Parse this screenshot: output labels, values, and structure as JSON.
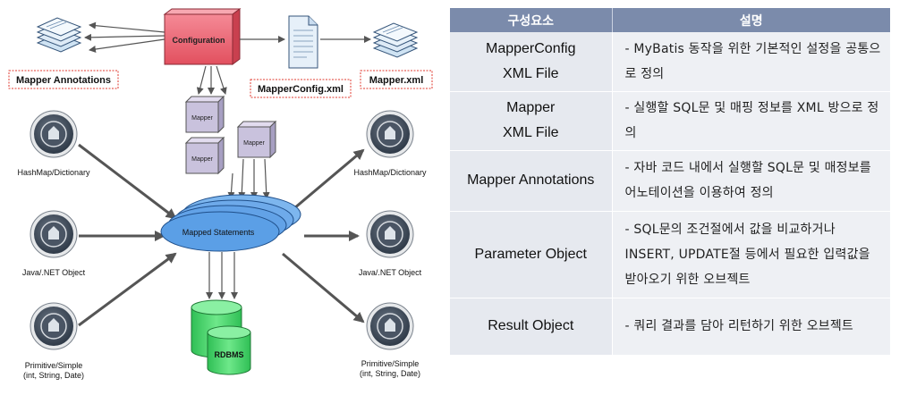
{
  "diagram": {
    "configuration": "Configuration",
    "mapper_annotations": "Mapper Annotations",
    "mapper_config_xml": "MapperConfig.xml",
    "mapper_xml": "Mapper.xml",
    "mapper": "Mapper",
    "mapped_statements": "Mapped Statements",
    "rdbms": "RDBMS",
    "inputs": [
      {
        "label": "HashMap/Dictionary"
      },
      {
        "label": "Java/.NET Object"
      },
      {
        "label_lines": [
          "Primitive/Simple",
          "(int, String, Date)"
        ]
      }
    ],
    "outputs": [
      {
        "label": "HashMap/Dictionary"
      },
      {
        "label": "Java/.NET Object"
      },
      {
        "label_lines": [
          "Primitive/Simple",
          "(int, String, Date)"
        ]
      }
    ],
    "colors": {
      "configuration_fill": "#f06b7a",
      "mapper_fill": "#c9c2dd",
      "ellipse_fill": "#5b9fe6",
      "db_fill": "#4bd36d",
      "label_border": "#e03a2f",
      "arrow": "#555555"
    }
  },
  "table": {
    "headers": [
      "구성요소",
      "설명"
    ],
    "rows": [
      {
        "name_lines": [
          "MapperConfig",
          "XML File"
        ],
        "desc": "- MyBatis 동작을 위한 기본적인 설정을 공통으로 정의"
      },
      {
        "name_lines": [
          "Mapper",
          "XML File"
        ],
        "desc": "- 실행할 SQL문 및 매핑 정보를 XML 방으로 정의"
      },
      {
        "name_lines": [
          "Mapper Annotations"
        ],
        "desc": "- 자바 코드 내에서 실행할 SQL문 및 매정보를 어노테이션을 이용하여 정의"
      },
      {
        "name_lines": [
          "Parameter Object"
        ],
        "desc": "- SQL문의 조건절에서 값을 비교하거나 INSERT, UPDATE절 등에서 필요한 입력값을 받아오기 위한 오브젝트"
      },
      {
        "name_lines": [
          "Result Object"
        ],
        "desc": "- 쿼리 결과를 담아 리턴하기 위한 오브젝트"
      }
    ]
  }
}
